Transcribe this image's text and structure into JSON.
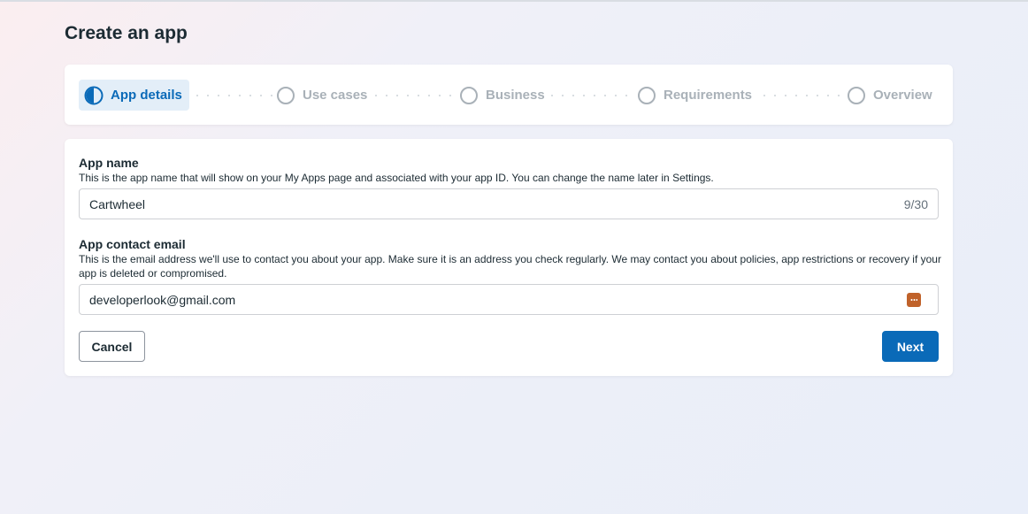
{
  "page": {
    "title": "Create an app"
  },
  "stepper": {
    "steps": [
      {
        "label": "App details",
        "state": "active"
      },
      {
        "label": "Use cases",
        "state": "inactive"
      },
      {
        "label": "Business",
        "state": "inactive"
      },
      {
        "label": "Requirements",
        "state": "inactive"
      },
      {
        "label": "Overview",
        "state": "inactive"
      }
    ]
  },
  "form": {
    "app_name": {
      "label": "App name",
      "help": "This is the app name that will show on your My Apps page and associated with your app ID. You can change the name later in Settings.",
      "value": "Cartwheel",
      "counter": "9/30"
    },
    "contact_email": {
      "label": "App contact email",
      "help": "This is the email address we'll use to contact you about your app. Make sure it is an address you check regularly. We may contact you about policies, app restrictions or recovery if your app is deleted or compromised.",
      "value": "developerlook@gmail.com",
      "autofill_icon": "password-manager-icon"
    },
    "cancel_label": "Cancel",
    "next_label": "Next"
  },
  "colors": {
    "accent": "#0a6ab8",
    "active_step_bg": "#e3eef8",
    "inactive_step": "#a9b1b8",
    "autofill_icon": "#c0622a"
  }
}
